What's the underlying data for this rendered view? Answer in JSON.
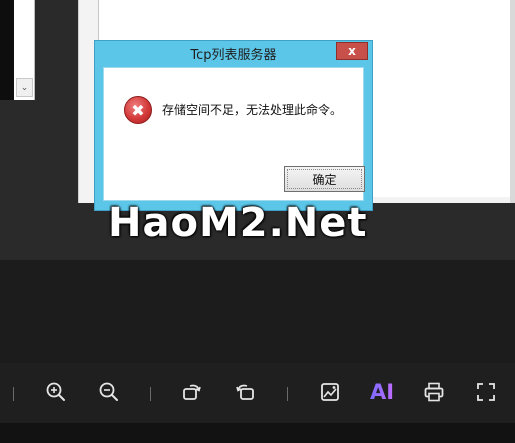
{
  "dialog": {
    "title": "Tcp列表服务器",
    "close_label": "x",
    "message": "存储空间不足，无法处理此命令。",
    "ok_label": "确定"
  },
  "watermark": {
    "text": "HaoM2.Net"
  },
  "toolbar": {
    "ai_label": "AI",
    "buttons": [
      {
        "name": "zoom-in-icon"
      },
      {
        "name": "zoom-out-icon"
      },
      {
        "name": "rotate-right-icon"
      },
      {
        "name": "rotate-left-icon"
      },
      {
        "name": "image-edit-icon"
      },
      {
        "name": "ai-icon"
      },
      {
        "name": "print-icon"
      },
      {
        "name": "fullscreen-icon"
      }
    ]
  },
  "colors": {
    "dialog_frame": "#5bc6e8",
    "close_button": "#c7504a",
    "error_icon": "#d33a3a",
    "toolbar_bg": "#1f1f1f",
    "ai_gradient_start": "#7b6cff",
    "ai_gradient_end": "#c06cff"
  }
}
